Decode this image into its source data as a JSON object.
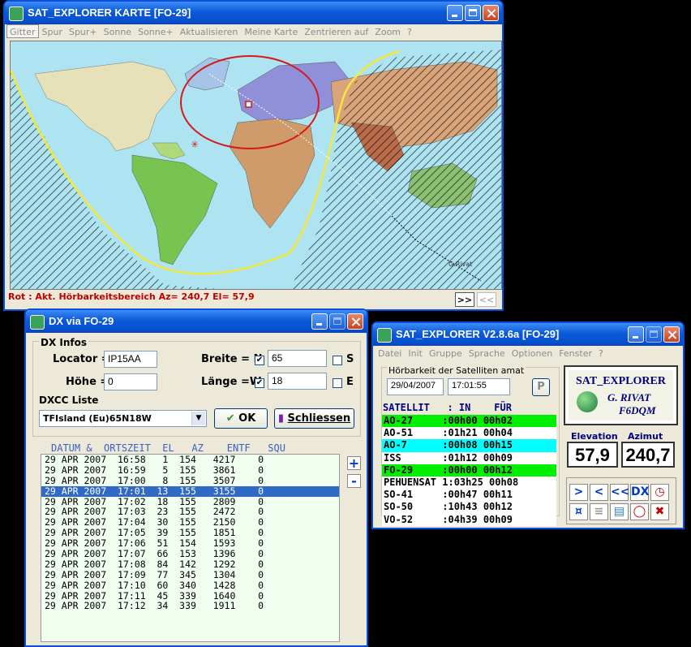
{
  "map_window": {
    "title": "SAT_EXPLORER KARTE [FO-29]",
    "menu": [
      "Gitter",
      "Spur",
      "Spur+",
      "Sonne",
      "Sonne+",
      "Aktualisieren",
      "Meine Karte",
      "Zentrieren auf",
      "Zoom",
      "?"
    ],
    "map_credit": "G.Rivat",
    "status": "Rot : Akt. Hörbarkeitsbereich Az= 240,7   El= 57,9",
    "next_label": ">>",
    "prev_label": "<<"
  },
  "dx_window": {
    "title": "DX via FO-29",
    "group_label": "DX Infos",
    "locator_label": "Locator =",
    "locator_value": "IP15AA",
    "hoehe_label": "Höhe =",
    "hoehe_value": "0",
    "breite_label": "Breite = N",
    "breite_value": "65",
    "breite_s_label": "S",
    "laenge_label": "Länge =W",
    "laenge_value": "18",
    "laenge_e_label": "E",
    "dxcc_label": "DXCC Liste",
    "dxcc_value": "TFIsland (Eu)65N18W",
    "ok_label": "OK",
    "close_label": "Schliessen",
    "list_header": "DATUM &  ORTSZEIT  EL   AZ    ENTF   SQU",
    "rows": [
      "29 APR 2007  16:58   1  154   4217    0",
      "29 APR 2007  16:59   5  155   3861    0",
      "29 APR 2007  17:00   8  155   3507    0",
      "29 APR 2007  17:01  13  155   3155    0",
      "29 APR 2007  17:02  18  155   2809    0",
      "29 APR 2007  17:03  23  155   2472    0",
      "29 APR 2007  17:04  30  155   2150    0",
      "29 APR 2007  17:05  39  155   1851    0",
      "29 APR 2007  17:06  51  154   1593    0",
      "29 APR 2007  17:07  66  153   1396    0",
      "29 APR 2007  17:08  84  142   1292    0",
      "29 APR 2007  17:09  77  345   1304    0",
      "29 APR 2007  17:10  60  340   1428    0",
      "29 APR 2007  17:11  45  339   1640    0",
      "29 APR 2007  17:12  34  339   1911    0"
    ],
    "selected_row": 3,
    "plus_label": "+",
    "minus_label": "-"
  },
  "sat_window": {
    "title": "SAT_EXPLORER V2.8.6a  [FO-29]",
    "menu": [
      "Datei",
      "Init",
      "Gruppe",
      "Sprache",
      "Optionen",
      "Fenster",
      "?"
    ],
    "group_label": "Hörbarkeit der Satelliten  amat",
    "date": "29/04/2007",
    "time": "17:01:55",
    "p_label": "P",
    "col_header": "SATELLIT   : IN    FÜR",
    "satellites": [
      {
        "text": "AO-27     :00h00 00h02",
        "color": "#00ee00"
      },
      {
        "text": "AO-51     :01h21 00h04",
        "color": "#ffffff"
      },
      {
        "text": "AO-7      :00h08 00h15",
        "color": "#00ffff"
      },
      {
        "text": "ISS       :01h12 00h09",
        "color": "#ffffff"
      },
      {
        "text": "FO-29     :00h00 00h12",
        "color": "#00ee00"
      },
      {
        "text": "PEHUENSAT 1:03h25 00h08",
        "color": "#ffffff"
      },
      {
        "text": "SO-41     :00h47 00h11",
        "color": "#ffffff"
      },
      {
        "text": "SO-50     :10h43 00h12",
        "color": "#ffffff"
      },
      {
        "text": "VO-52     :04h39 00h09",
        "color": "#ffffff"
      }
    ],
    "logo_title": "SAT_EXPLORER",
    "logo_author": "G. RIVAT",
    "logo_call": "F6DQM",
    "elevation_label": "Elevation",
    "elevation_value": "57,9",
    "azimuth_label": "Azimut",
    "azimuth_value": "240,7",
    "ctrl_next": ">",
    "ctrl_prev": "<",
    "ctrl_prev2": "<<",
    "ctrl_dx": "DX"
  }
}
